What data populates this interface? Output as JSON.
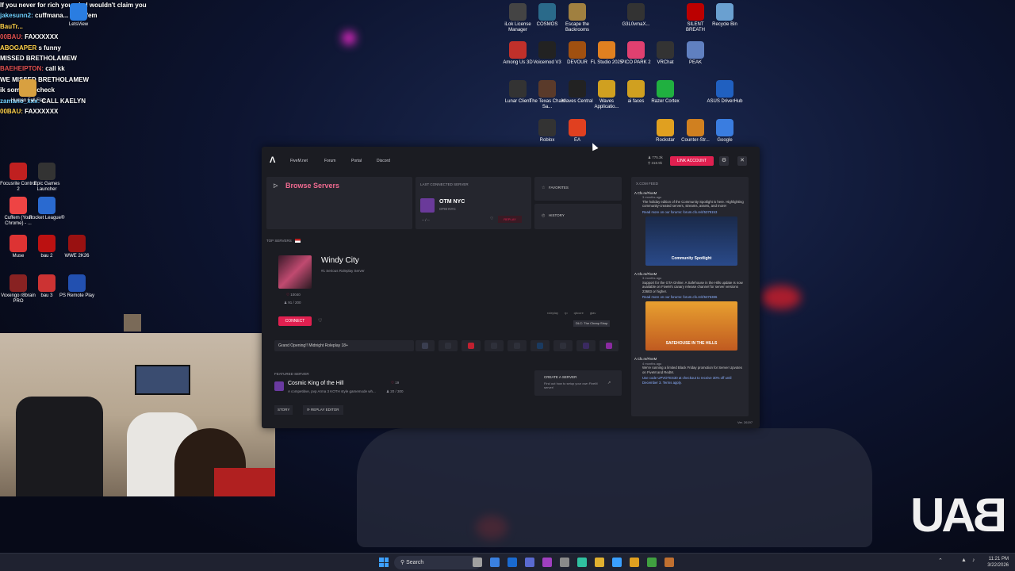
{
  "chat": [
    {
      "user": "",
      "text": "If you never for rich your dad wouldn't claim you",
      "c": "u1"
    },
    {
      "user": "jakesunn2:",
      "text": "cuffmana... @cuffem",
      "c": "u2"
    },
    {
      "user": "BauTr...",
      "text": "",
      "c": "u3"
    },
    {
      "user": "00BAU:",
      "text": "FAXXXXXX",
      "c": "u1"
    },
    {
      "user": "ABOGAPER",
      "text": "s funny",
      "c": "u3"
    },
    {
      "user": "",
      "text": "MISSED BRETHOLAMEW",
      "c": "u2"
    },
    {
      "user": "",
      "text": "",
      "c": "u2"
    },
    {
      "user": "BAEHEIPTON:",
      "text": "call kk",
      "c": "u1"
    },
    {
      "user": "",
      "text": "",
      "c": "u2"
    },
    {
      "user": "",
      "text": "WE MISSED BRETHOLAMEW",
      "c": "u2"
    },
    {
      "user": "",
      "text": "",
      "c": "u2"
    },
    {
      "user": "",
      "text": "",
      "c": "u1"
    },
    {
      "user": "",
      "text": "",
      "c": "u2"
    },
    {
      "user": "",
      "text": "ik someone check",
      "c": "u2"
    },
    {
      "user": "zamano_xxx:",
      "text": "CALL KAELYN",
      "c": "u2"
    },
    {
      "user": "00BAU:",
      "text": "FAXXXXXX",
      "c": "u3"
    }
  ],
  "desktop_left": [
    {
      "label": "LetsView",
      "color": "#2a7de1"
    },
    {
      "label": "Human Fall Flat",
      "color": "#d8a040"
    },
    {
      "label": "Focusrite Control 2",
      "color": "#c02020"
    },
    {
      "label": "Epic Games Launcher",
      "color": "#333"
    },
    {
      "label": "Cuffem (Your Chrome) - ...",
      "color": "#e44"
    },
    {
      "label": "Rocket League®",
      "color": "#2a6ad0"
    },
    {
      "label": "Muse",
      "color": "#d33"
    },
    {
      "label": "bau 2",
      "color": "#b11"
    },
    {
      "label": "WWE 2K26",
      "color": "#911"
    },
    {
      "label": "Voxengo r8brain PRO",
      "color": "#822"
    },
    {
      "label": "bau 3",
      "color": "#c33"
    },
    {
      "label": "PS Remote Play",
      "color": "#2250b0"
    }
  ],
  "desktop_right": [
    {
      "label": "iLok License Manager",
      "color": "#444"
    },
    {
      "label": "COSMOS",
      "color": "#2a6a8a"
    },
    {
      "label": "Escape the Backrooms",
      "color": "#a08040"
    },
    {
      "label": "G3L0vmaX...",
      "color": "#333"
    },
    {
      "label": "SILENT BREATH",
      "color": "#b00"
    },
    {
      "label": "Recycle Bin",
      "color": "#6aa0d0"
    },
    {
      "label": "Among Us 3D",
      "color": "#c0302a"
    },
    {
      "label": "Voicemod V3",
      "color": "#222"
    },
    {
      "label": "DEVOUR",
      "color": "#a05010"
    },
    {
      "label": "FL Studio 2025",
      "color": "#e08020"
    },
    {
      "label": "PICO PARK 2",
      "color": "#e04070"
    },
    {
      "label": "VRChat",
      "color": "#333"
    },
    {
      "label": "PEAK",
      "color": "#6080c0"
    },
    {
      "label": "Lunar Client",
      "color": "#333"
    },
    {
      "label": "The Texas Chain Sa...",
      "color": "#5a3a2a"
    },
    {
      "label": "Waves Central",
      "color": "#222"
    },
    {
      "label": "Waves Applicatio...",
      "color": "#d0a020"
    },
    {
      "label": "ai faces",
      "color": "#d0a020"
    },
    {
      "label": "Razer Cortex",
      "color": "#20b040"
    },
    {
      "label": "ASUS DriverHub",
      "color": "#2060c0"
    },
    {
      "label": "Roblox",
      "color": "#333"
    },
    {
      "label": "EA",
      "color": "#e04020"
    },
    {
      "label": "Rockstar",
      "color": "#e0a020"
    },
    {
      "label": "Counter-Str...",
      "color": "#d08020"
    },
    {
      "label": "Google",
      "color": "#3a7de0"
    }
  ],
  "fivem": {
    "logo": "Λ",
    "nav": [
      "FiveM.net",
      "Forum",
      "Portal",
      "Discord"
    ],
    "players_online": "775.3k",
    "servers_online": "318.9k",
    "link_account": "LINK ACCOUNT",
    "browse_servers": "Browse Servers",
    "last_connected_label": "LAST CONNECTED SERVER",
    "last_server_name": "OTM NYC",
    "last_server_sub": "OTM NYC",
    "last_server_players": "-- / --",
    "last_server_action": "REPLAY",
    "favorites": "FAVORITES",
    "history": "HISTORY",
    "top_servers": "TOP SERVERS",
    "featured_name": "Windy City",
    "featured_desc": "#1 Serious Roleplay Server",
    "featured_likes": "10040",
    "featured_players": "91 / 200",
    "connect": "CONNECT",
    "featured_tags": [
      "roleplay",
      "rp",
      "qbcore",
      "gtav"
    ],
    "featured_badge": "DLC: The Cheap Shop",
    "server_list_item": "Grand Opening!! Midnight Roleplay 18+",
    "featured_servers": "FEATURED SERVER",
    "cosmic_name": "Cosmic King of the Hill",
    "cosmic_desc": "A competitive, pvp Arma 3 KOTH style gamemode wh...",
    "cosmic_players": "20 / 300",
    "cosmic_likes": "19",
    "create_server": "CREATE A SERVER",
    "create_server_desc": "Find out how to setup your own FiveM server!",
    "story": "STORY",
    "replay_editor": "REPLAY EDITOR",
    "version": "Ver. 26197",
    "feed_title": "X.COM FEED",
    "feed": [
      {
        "author": "Cfx.re/FiveM",
        "time": "3 months ago",
        "text": "The holiday edition of the Community Spotlight is here. Highlighting community-created servers, streams, assets, and more!",
        "link": "Read more on our forums: forum.cfx.re/t/5379153",
        "img": "Community Spotlight"
      },
      {
        "author": "Cfx.re/FiveM",
        "time": "3 months ago",
        "text": "Support for the GTA Online: A Safehouse in the Hills update is now available on FiveM's canary release channel for server versions 23683 or higher.",
        "link": "Read more on our forums: forum.cfx.re/t/5375386",
        "img": "SAFEHOUSE IN THE HILLS"
      },
      {
        "author": "Cfx.re/FiveM",
        "time": "4 months ago",
        "text": "We're running a limited Black Friday promotion for Server Upvotes on FiveM and RedM.",
        "link": "Use code UPVOTES30 at checkout to receive 30% off until December 3. Terms apply.",
        "img": ""
      }
    ]
  },
  "taskbar": {
    "search": "Search",
    "time": "11:21 PM",
    "date": "3/22/2026"
  },
  "watermark": "BAU"
}
